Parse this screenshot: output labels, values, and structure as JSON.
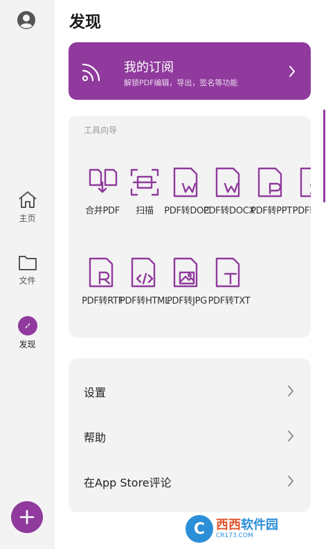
{
  "page": {
    "title": "发现"
  },
  "sidebar": {
    "items": [
      {
        "label": "主页",
        "icon": "home-icon"
      },
      {
        "label": "文件",
        "icon": "folder-icon"
      },
      {
        "label": "发现",
        "icon": "compass-icon"
      }
    ]
  },
  "subscription": {
    "title": "我的订阅",
    "description": "解锁PDF编辑，导出，签名等功能"
  },
  "tools": {
    "heading": "工具向导",
    "items": [
      {
        "label": "合并PDF",
        "icon": "merge-pdf-icon"
      },
      {
        "label": "扫描",
        "icon": "scan-icon"
      },
      {
        "label": "PDF转DOC",
        "icon": "pdf-to-doc-icon"
      },
      {
        "label": "PDF转DOCX",
        "icon": "pdf-to-docx-icon"
      },
      {
        "label": "PDF转PPT",
        "icon": "pdf-to-ppt-icon"
      },
      {
        "label": "PDF转XLS",
        "icon": "pdf-to-xls-icon"
      },
      {
        "label": "PDF转RTF",
        "icon": "pdf-to-rtf-icon"
      },
      {
        "label": "PDF转HTML",
        "icon": "pdf-to-html-icon"
      },
      {
        "label": "PDF转JPG",
        "icon": "pdf-to-jpg-icon"
      },
      {
        "label": "PDF转TXT",
        "icon": "pdf-to-txt-icon"
      }
    ]
  },
  "menu": {
    "items": [
      {
        "label": "设置"
      },
      {
        "label": "帮助"
      },
      {
        "label": "在App Store评论"
      }
    ]
  },
  "watermark": {
    "logo": "C",
    "name_a": "西西",
    "name_b": "软件园",
    "url": "CR173.COM"
  },
  "colors": {
    "accent": "#8f3a9c",
    "card": "#f3f3f3",
    "sidebar": "#f3f3f3"
  }
}
